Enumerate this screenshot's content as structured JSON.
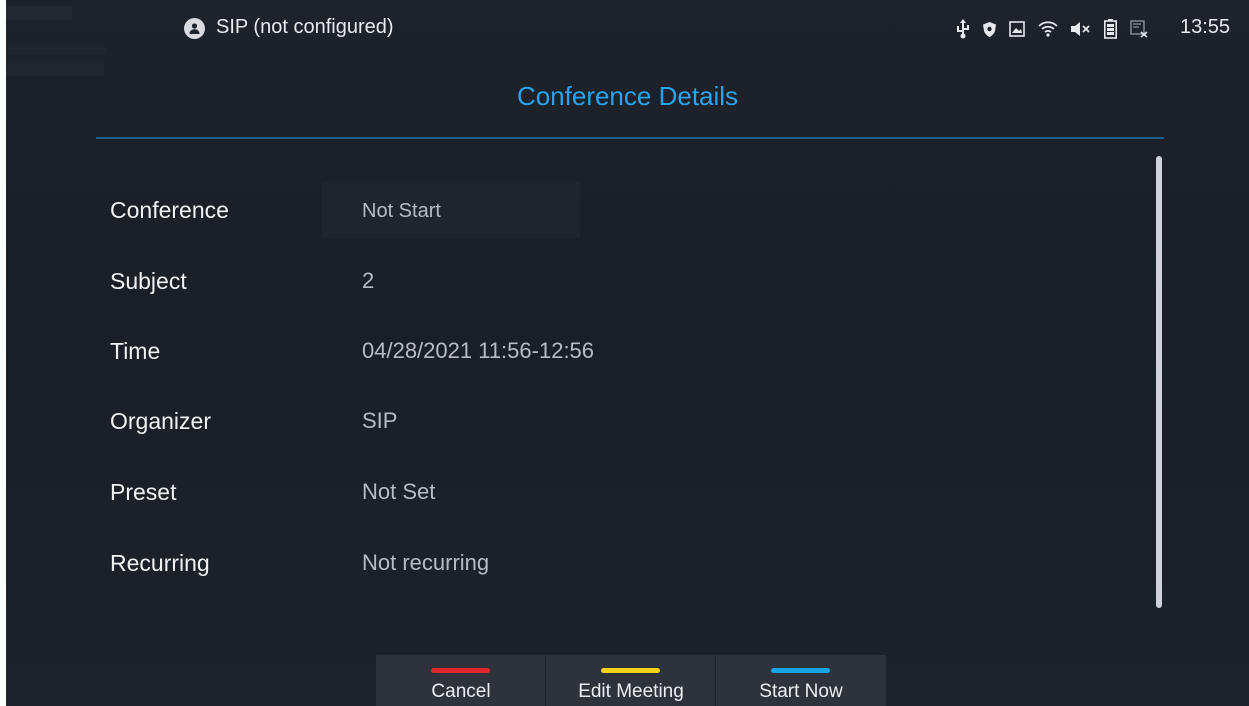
{
  "status_bar": {
    "account_label": "SIP (not configured)",
    "time": "13:55",
    "icons": [
      "usb-icon",
      "shield-icon",
      "image-icon",
      "wifi-icon",
      "volume-mute-icon",
      "battery-icon",
      "screen-cast-icon"
    ]
  },
  "page": {
    "title": "Conference Details"
  },
  "details": [
    {
      "label": "Conference",
      "value": "Not Start"
    },
    {
      "label": "Subject",
      "value": "2"
    },
    {
      "label": "Time",
      "value": "04/28/2021 11:56-12:56"
    },
    {
      "label": "Organizer",
      "value": "SIP"
    },
    {
      "label": "Preset",
      "value": "Not Set"
    },
    {
      "label": "Recurring",
      "value": "Not recurring"
    }
  ],
  "softkeys": [
    {
      "label": "Cancel",
      "color": "#e0282c"
    },
    {
      "label": "Edit Meeting",
      "color": "#f3d21c"
    },
    {
      "label": "Start Now",
      "color": "#18a4e0"
    }
  ],
  "colors": {
    "accent": "#2aa3ee",
    "background": "#1b2028"
  }
}
